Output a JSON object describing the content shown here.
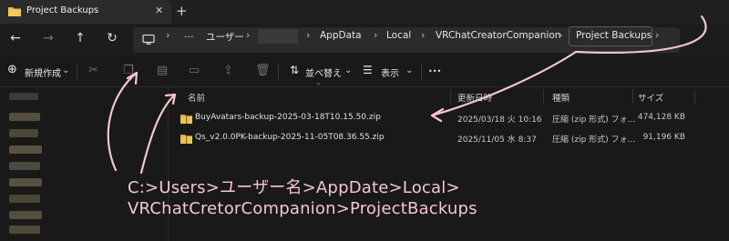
{
  "window": {
    "tab_title": "Project Backups",
    "tab_close": "✕",
    "new_tab": "+"
  },
  "nav": {
    "back": "←",
    "forward": "→",
    "up": "↑",
    "refresh": "↻"
  },
  "address": {
    "crumbs": [
      "…",
      "ユーザー",
      "AppData",
      "Local",
      "VRChatCreatorCompanion",
      "Project Backups"
    ],
    "separator": "›"
  },
  "commandbar": {
    "new_label": "新規作成",
    "sort_label": "並べ替え",
    "view_label": "表示",
    "more": "•••"
  },
  "columns": {
    "name": "名前",
    "date": "更新日時",
    "type": "種類",
    "size": "サイズ"
  },
  "files": [
    {
      "name": "BuyAvatars-backup-2025-03-18T10.15.50.zip",
      "date": "2025/03/18 火 10:16",
      "type": "圧縮 (zip 形式) フォ...",
      "size": "474,128 KB"
    },
    {
      "name": "Qs_v2.0.0PK-backup-2025-11-05T08.36.55.zip",
      "date": "2025/11/05 水 8:37",
      "type": "圧縮 (zip 形式) フォ...",
      "size": "91,196 KB"
    }
  ],
  "annotation": {
    "line1": "C:>Users>ユーザー名>AppDate>Local>",
    "line2": "VRChatCretorCompanion>ProjectBackups"
  },
  "colors": {
    "folder": "#e8b84a",
    "annotation": "#f5c6cf"
  }
}
